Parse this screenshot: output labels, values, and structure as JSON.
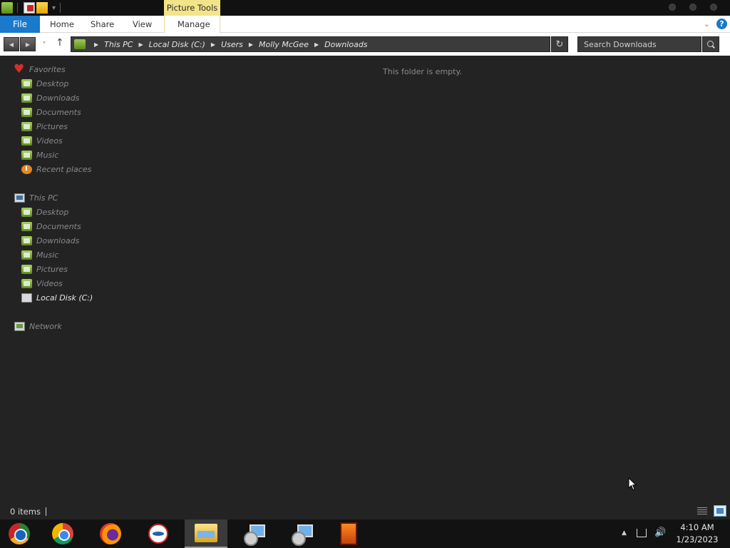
{
  "titlebar": {
    "contextual_tab_group": "Picture Tools"
  },
  "ribbon": {
    "tabs": {
      "file": "File",
      "home": "Home",
      "share": "Share",
      "view": "View",
      "manage": "Manage"
    },
    "help_icon_glyph": "?"
  },
  "address": {
    "breadcrumb": [
      "This PC",
      "Local Disk (C:)",
      "Users",
      "Molly McGee",
      "Downloads"
    ],
    "search_placeholder": "Search Downloads"
  },
  "navpane": {
    "favorites": {
      "header": "Favorites",
      "items": [
        "Desktop",
        "Downloads",
        "Documents",
        "Pictures",
        "Videos",
        "Music",
        "Recent places"
      ]
    },
    "this_pc": {
      "header": "This PC",
      "items": [
        "Desktop",
        "Documents",
        "Downloads",
        "Music",
        "Pictures",
        "Videos",
        "Local Disk (C:)"
      ],
      "selected": "Local Disk (C:)"
    },
    "network": {
      "header": "Network"
    }
  },
  "content": {
    "empty_message": "This folder is empty."
  },
  "statusbar": {
    "items_count": "0 items"
  },
  "taskbar": {
    "apps": [
      "chromium-icon",
      "chrome-icon",
      "firefox-icon",
      "opera-icon",
      "file-explorer-icon",
      "setup-installer-icon",
      "setup-installer-icon",
      "orange-app-icon"
    ],
    "active_app": "file-explorer-icon"
  },
  "clock": {
    "time": "4:10 AM",
    "date": "1/23/2023"
  },
  "colors": {
    "file_tab": "#1979ca",
    "picture_tools": "#f2e48a",
    "background": "#232323",
    "taskbar": "#121212"
  }
}
